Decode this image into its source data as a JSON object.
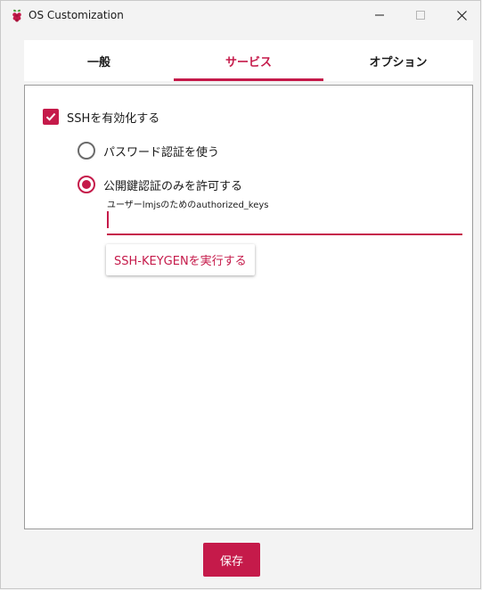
{
  "window": {
    "title": "OS Customization",
    "controls": [
      "minimize",
      "maximize",
      "close"
    ]
  },
  "tabs": [
    {
      "label": "一般",
      "active": false
    },
    {
      "label": "サービス",
      "active": true
    },
    {
      "label": "オプション",
      "active": false
    }
  ],
  "services": {
    "ssh_enable": {
      "label": "SSHを有効化する",
      "checked": true
    },
    "auth_options": [
      {
        "label": "パスワード認証を使う",
        "selected": false
      },
      {
        "label": "公開鍵認証のみを許可する",
        "selected": true
      }
    ],
    "authorized_keys": {
      "label": "ユーザーlmjsのためのauthorized_keys",
      "value": ""
    },
    "keygen_button": "SSH-KEYGENを実行する"
  },
  "footer": {
    "save_label": "保存"
  },
  "colors": {
    "accent": "#c51a4a",
    "background": "#f3f3f3",
    "panel": "#ffffff"
  }
}
